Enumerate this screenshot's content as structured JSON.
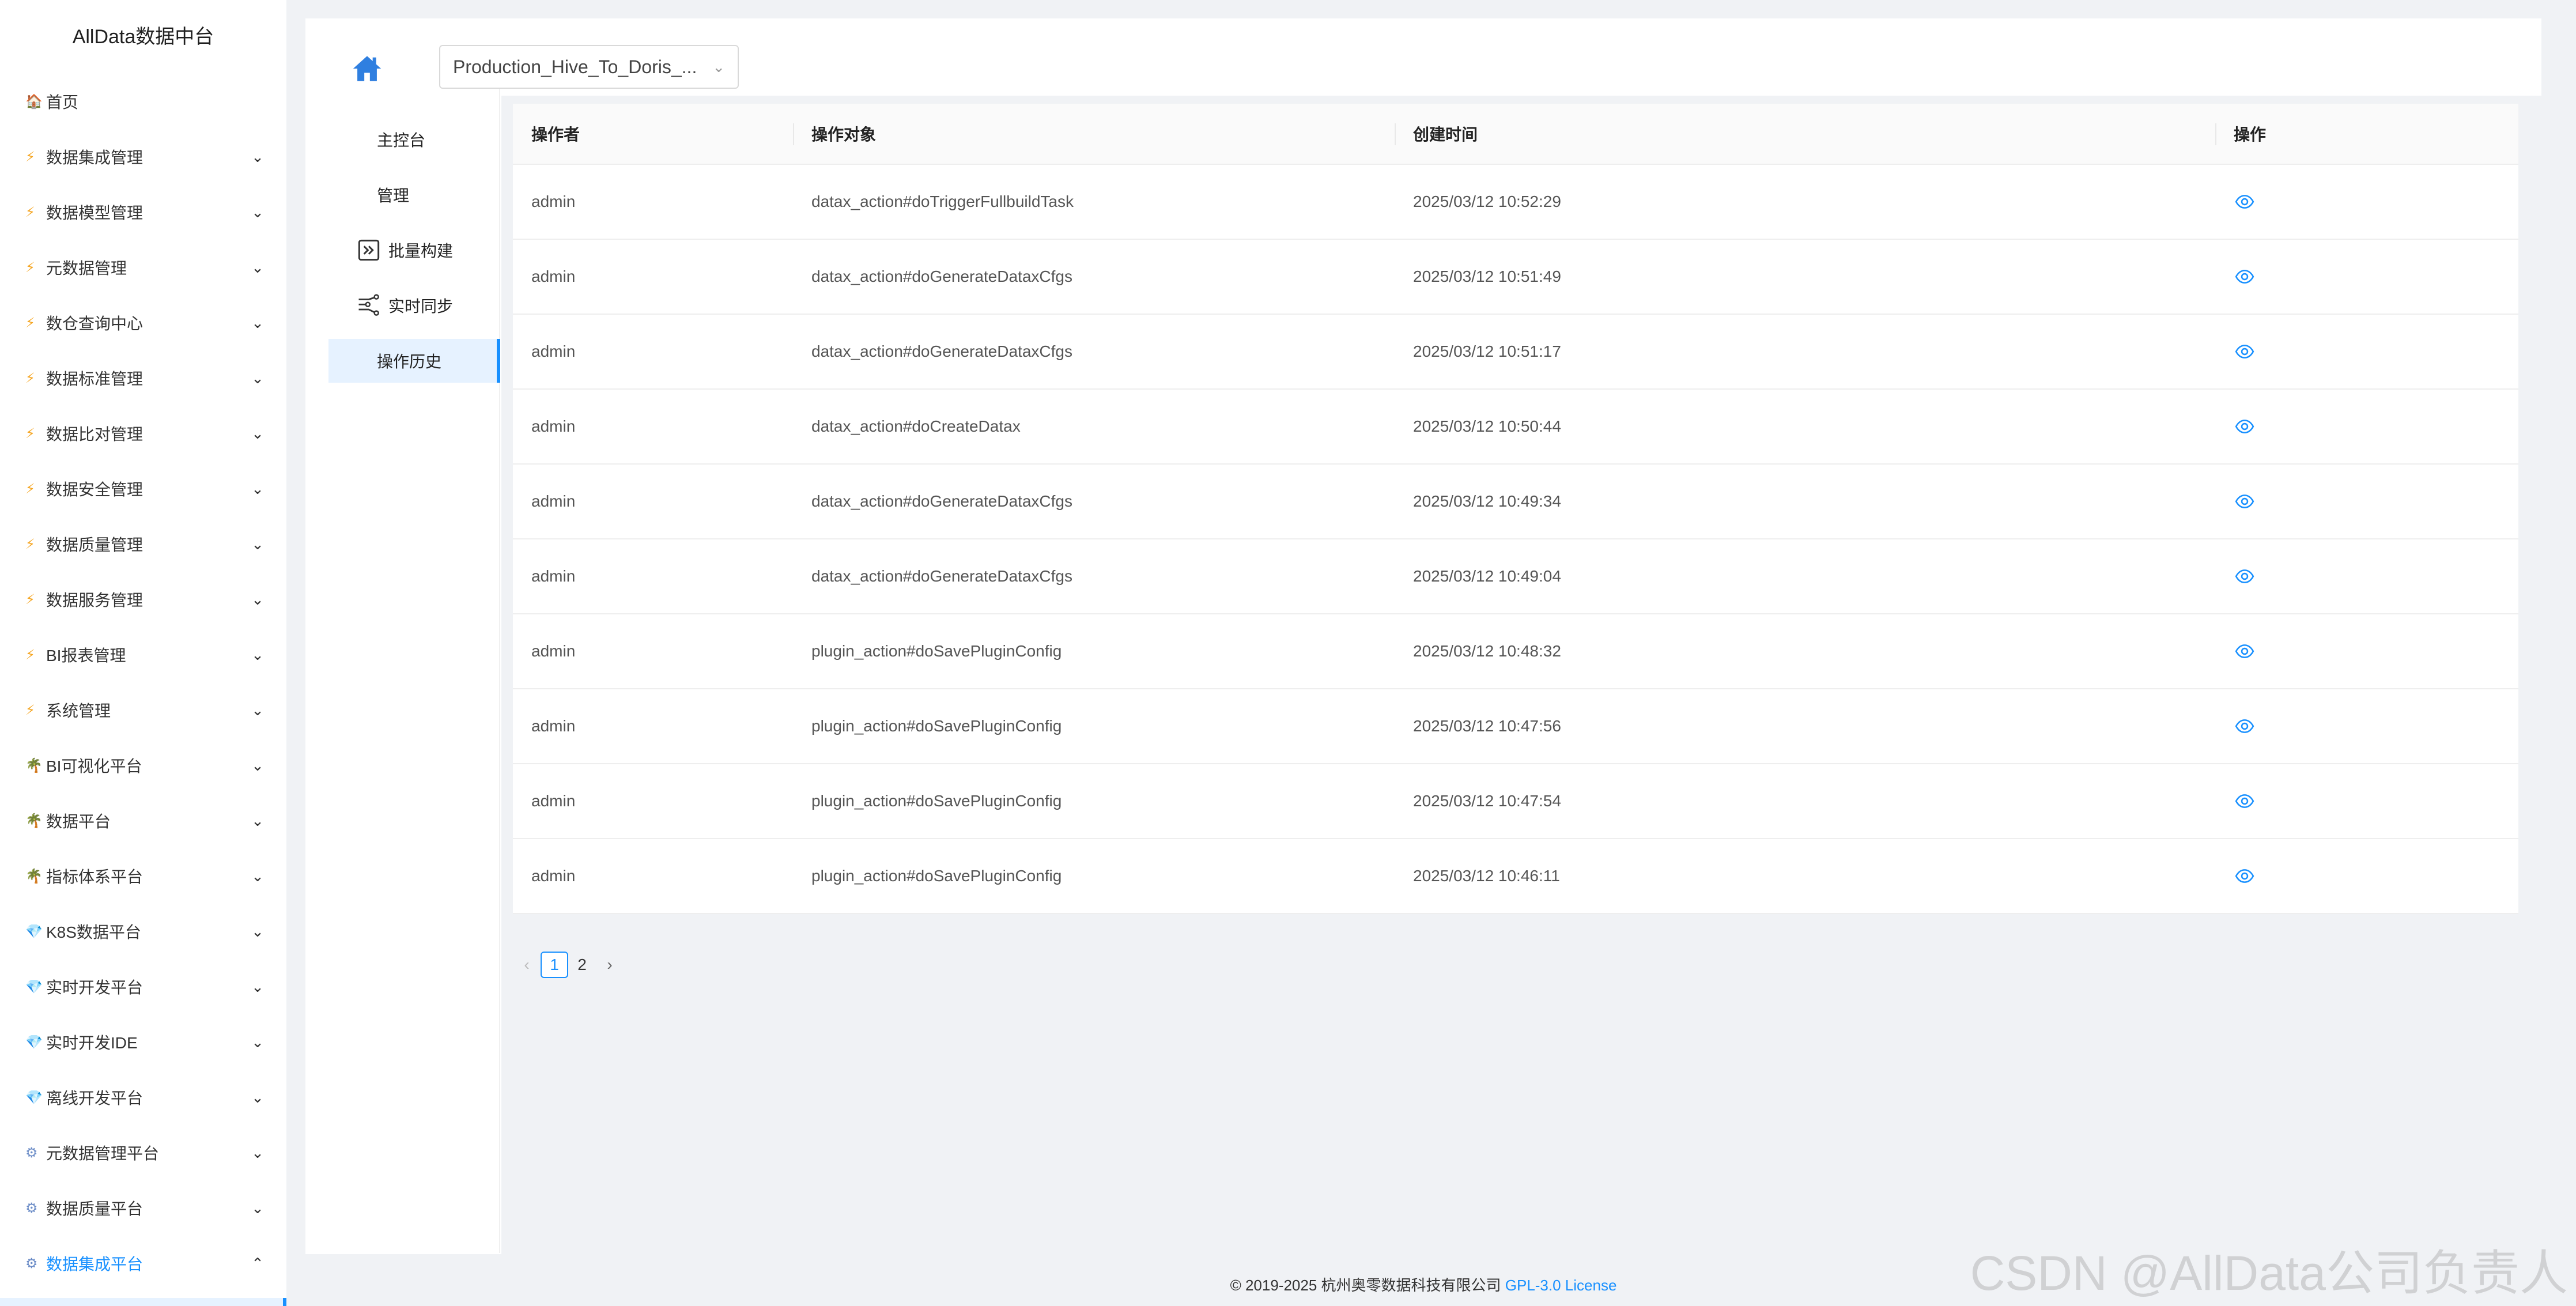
{
  "brand": "AllData数据中台",
  "sidebar": {
    "items": [
      {
        "icon": "home-icon",
        "glyph": "🏠",
        "label": "首页",
        "expandable": false
      },
      {
        "icon": "bolt-icon",
        "glyph": "⚡",
        "label": "数据集成管理",
        "expandable": true
      },
      {
        "icon": "bolt-icon",
        "glyph": "⚡",
        "label": "数据模型管理",
        "expandable": true
      },
      {
        "icon": "bolt-icon",
        "glyph": "⚡",
        "label": "元数据管理",
        "expandable": true
      },
      {
        "icon": "bolt-icon",
        "glyph": "⚡",
        "label": "数仓查询中心",
        "expandable": true
      },
      {
        "icon": "bolt-icon",
        "glyph": "⚡",
        "label": "数据标准管理",
        "expandable": true
      },
      {
        "icon": "bolt-icon",
        "glyph": "⚡",
        "label": "数据比对管理",
        "expandable": true
      },
      {
        "icon": "bolt-icon",
        "glyph": "⚡",
        "label": "数据安全管理",
        "expandable": true
      },
      {
        "icon": "bolt-icon",
        "glyph": "⚡",
        "label": "数据质量管理",
        "expandable": true
      },
      {
        "icon": "bolt-icon",
        "glyph": "⚡",
        "label": "数据服务管理",
        "expandable": true
      },
      {
        "icon": "bolt-icon",
        "glyph": "⚡",
        "label": "BI报表管理",
        "expandable": true
      },
      {
        "icon": "bolt-icon",
        "glyph": "⚡",
        "label": "系统管理",
        "expandable": true
      },
      {
        "icon": "plant-icon",
        "glyph": "🌴",
        "label": "BI可视化平台",
        "expandable": true
      },
      {
        "icon": "plant-icon",
        "glyph": "🌴",
        "label": "数据平台",
        "expandable": true
      },
      {
        "icon": "plant-icon",
        "glyph": "🌴",
        "label": "指标体系平台",
        "expandable": true
      },
      {
        "icon": "gem-icon",
        "glyph": "💎",
        "label": "K8S数据平台",
        "expandable": true
      },
      {
        "icon": "gem-icon",
        "glyph": "💎",
        "label": "实时开发平台",
        "expandable": true
      },
      {
        "icon": "gem-icon",
        "glyph": "💎",
        "label": "实时开发IDE",
        "expandable": true
      },
      {
        "icon": "gem-icon",
        "glyph": "💎",
        "label": "离线开发平台",
        "expandable": true
      },
      {
        "icon": "gears-icon",
        "glyph": "⚙",
        "label": "元数据管理平台",
        "expandable": true
      },
      {
        "icon": "gears-icon",
        "glyph": "⚙",
        "label": "数据质量平台",
        "expandable": true
      },
      {
        "icon": "gears-icon",
        "glyph": "⚙",
        "label": "数据集成平台",
        "expandable": true,
        "active": true,
        "expanded": true
      }
    ]
  },
  "topbar": {
    "pipeline_value": "Production_Hive_To_Doris_...",
    "home_icon": "home-icon"
  },
  "subnav": {
    "items": [
      {
        "label": "主控台",
        "icon": null
      },
      {
        "label": "管理",
        "icon": null
      },
      {
        "label": "批量构建",
        "icon": "batch-build-icon"
      },
      {
        "label": "实时同步",
        "icon": "realtime-sync-icon"
      },
      {
        "label": "操作历史",
        "icon": null,
        "active": true
      }
    ]
  },
  "table": {
    "columns": [
      "操作者",
      "操作对象",
      "创建时间",
      "操作"
    ],
    "rows": [
      {
        "operator": "admin",
        "target": "datax_action#doTriggerFullbuildTask",
        "created": "2025/03/12 10:52:29"
      },
      {
        "operator": "admin",
        "target": "datax_action#doGenerateDataxCfgs",
        "created": "2025/03/12 10:51:49"
      },
      {
        "operator": "admin",
        "target": "datax_action#doGenerateDataxCfgs",
        "created": "2025/03/12 10:51:17"
      },
      {
        "operator": "admin",
        "target": "datax_action#doCreateDatax",
        "created": "2025/03/12 10:50:44"
      },
      {
        "operator": "admin",
        "target": "datax_action#doGenerateDataxCfgs",
        "created": "2025/03/12 10:49:34"
      },
      {
        "operator": "admin",
        "target": "datax_action#doGenerateDataxCfgs",
        "created": "2025/03/12 10:49:04"
      },
      {
        "operator": "admin",
        "target": "plugin_action#doSavePluginConfig",
        "created": "2025/03/12 10:48:32"
      },
      {
        "operator": "admin",
        "target": "plugin_action#doSavePluginConfig",
        "created": "2025/03/12 10:47:56"
      },
      {
        "operator": "admin",
        "target": "plugin_action#doSavePluginConfig",
        "created": "2025/03/12 10:47:54"
      },
      {
        "operator": "admin",
        "target": "plugin_action#doSavePluginConfig",
        "created": "2025/03/12 10:46:11"
      }
    ],
    "action_icon": "eye-icon"
  },
  "pagination": {
    "prev": "<",
    "pages": [
      "1",
      "2"
    ],
    "current": "1",
    "next": ">"
  },
  "footer": {
    "copyright": "© 2019-2025 杭州奥零数据科技有限公司 ",
    "license": "GPL-3.0 License"
  },
  "watermark": "CSDN @AllData公司负责人",
  "colors": {
    "accent": "#1890ff",
    "background": "#f0f2f5",
    "panel": "#ffffff"
  }
}
